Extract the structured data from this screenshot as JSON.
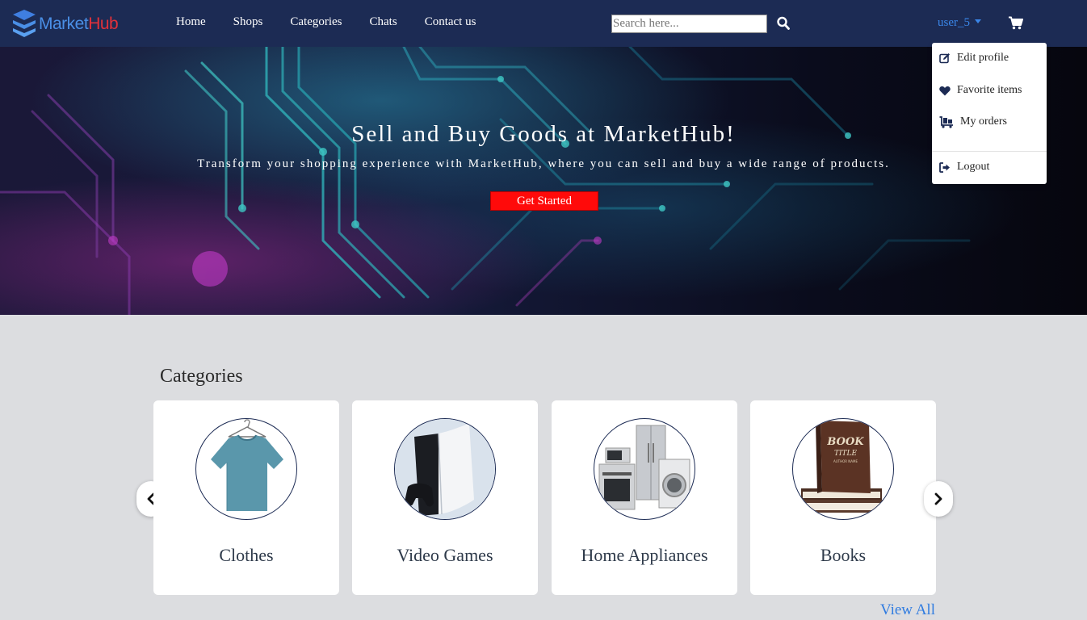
{
  "brand": {
    "part1": "Market",
    "part2": "Hub"
  },
  "nav": {
    "links": [
      "Home",
      "Shops",
      "Categories",
      "Chats",
      "Contact us"
    ]
  },
  "search": {
    "placeholder": "Search here..."
  },
  "user": {
    "name": "user_5"
  },
  "dropdown": {
    "items": [
      "Edit profile",
      "Favorite items",
      "My orders",
      "Logout"
    ]
  },
  "hero": {
    "title": "Sell and Buy Goods at MarketHub!",
    "subtitle": "Transform your shopping experience with MarketHub, where you can sell and buy a wide range of products.",
    "cta": "Get Started"
  },
  "categories": {
    "title": "Categories",
    "items": [
      "Clothes",
      "Video Games",
      "Home Appliances",
      "Books"
    ],
    "view_all": "View All"
  },
  "book_cover_text": [
    "BOOK",
    "TITLE",
    "AUTHOR NAME"
  ],
  "icons": {
    "search": "search-icon",
    "cart": "cart-icon",
    "edit": "edit-icon",
    "heart": "heart-icon",
    "orders": "cart-flatbed-icon",
    "logout": "logout-icon",
    "prev": "chevron-left-icon",
    "next": "chevron-right-icon"
  },
  "colors": {
    "navbar": "#1c2b54",
    "brand_blue": "#4a8fe6",
    "brand_red": "#e2313a",
    "cta": "#ff0a0a",
    "link": "#2f7be0"
  }
}
